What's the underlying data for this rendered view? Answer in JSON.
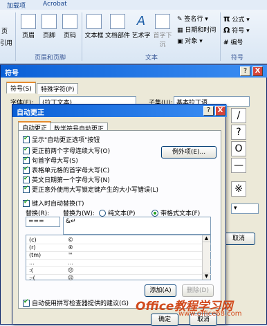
{
  "ribbon": {
    "tabs": [
      "加载项",
      "Acrobat"
    ],
    "left_fragments": [
      "页",
      "引用"
    ],
    "buttons": {
      "header": "页眉",
      "footer": "页脚",
      "page_number": "页码",
      "textbox": "文本框",
      "quick_parts": "文档部件",
      "wordart": "艺术字",
      "dropcap": "首字下沉"
    },
    "small_items": {
      "signature_line": "签名行",
      "datetime": "日期和时间",
      "object": "对象",
      "formula": "公式",
      "symbol": "符号",
      "numbering": "编号"
    },
    "groups": {
      "header_footer": "页眉和页脚",
      "text": "文本",
      "symbols": "符号"
    }
  },
  "symbol_dialog": {
    "title": "符号",
    "help": "?",
    "close": "X",
    "tabs": {
      "symbols": "符号(S)",
      "special": "特殊字符(P)"
    },
    "font_label": "字体(F):",
    "font_value": "(拉丁文本)",
    "subset_label": "子集(U):",
    "subset_value": "基本拉丁语",
    "cells": [
      "/",
      "?",
      "O",
      "—",
      "※"
    ],
    "cancel": "取消"
  },
  "autocorrect_dialog": {
    "title": "自动更正",
    "tabs": {
      "autocorrect": "自动更正",
      "math": "数学符号自动更正"
    },
    "options": [
      {
        "label": "显示\"自动更正选项\"按钮",
        "checked": true
      },
      {
        "label": "更正前两个字母连续大写(O)",
        "checked": true
      },
      {
        "label": "句首字母大写(S)",
        "checked": true
      },
      {
        "label": "表格单元格的首字母大写(C)",
        "checked": true
      },
      {
        "label": "英文日期第一个字母大写(N)",
        "checked": true
      },
      {
        "label": "更正意外使用大写锁定键产生的大小写错误(L)",
        "checked": true
      }
    ],
    "exceptions_button": "例外项(E)...",
    "replace_as_you_type": "键入时自动替换(T)",
    "replace_label": "替换(R):",
    "with_label": "替换为(W):",
    "plain_text": "纯文本(P)",
    "formatted_text": "带格式文本(F)",
    "replace_value": "===",
    "with_value": "&↵",
    "list": [
      {
        "key": "(c)",
        "val": "©"
      },
      {
        "key": "(r)",
        "val": "®"
      },
      {
        "key": "(tm)",
        "val": "™"
      },
      {
        "key": "...",
        "val": "…"
      },
      {
        "key": ":(",
        "val": "☹"
      },
      {
        "key": ":-(",
        "val": "☹"
      }
    ],
    "add_button": "添加(A)",
    "delete_button": "删除(D)",
    "spellcheck_option": "自动使用拼写检查器提供的建议(G)",
    "ok": "确定",
    "cancel": "取消"
  },
  "watermark": {
    "brand": "Office教程学习网",
    "url": "www.office68.com"
  }
}
